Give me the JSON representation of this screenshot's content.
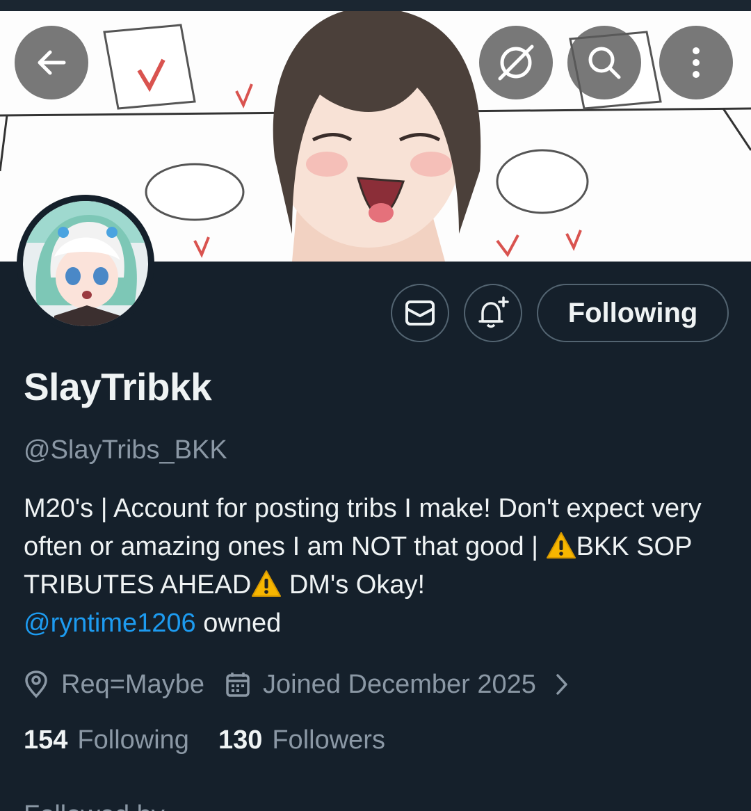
{
  "header": {
    "back_icon": "arrow-left-icon",
    "hide_icon": "eye-slash-circle-icon",
    "search_icon": "search-icon",
    "more_icon": "more-vertical-icon"
  },
  "profile": {
    "display_name": "SlayTribkk",
    "handle": "@SlayTribs_BKK",
    "bio": {
      "part1": "M20's  | Account for posting tribs I make! Don't expect very often or amazing ones I am NOT that good | ",
      "part2": "BKK SOP TRIBUTES AHEAD",
      "part3": " DM's Okay!",
      "mention": "@ryntime1206",
      "part4": " owned"
    },
    "location": "Req=Maybe",
    "joined": "Joined December 2025",
    "following_count": "154",
    "following_label": "Following",
    "followers_count": "130",
    "followers_label": "Followers",
    "followed_by_partial": "Followed by ..."
  },
  "actions": {
    "message_icon": "envelope-icon",
    "notify_icon": "bell-plus-icon",
    "following_button": "Following"
  },
  "colors": {
    "background": "#15202b",
    "text": "#eff3f4",
    "secondary": "#8b98a5",
    "accent": "#1d9bf0"
  }
}
